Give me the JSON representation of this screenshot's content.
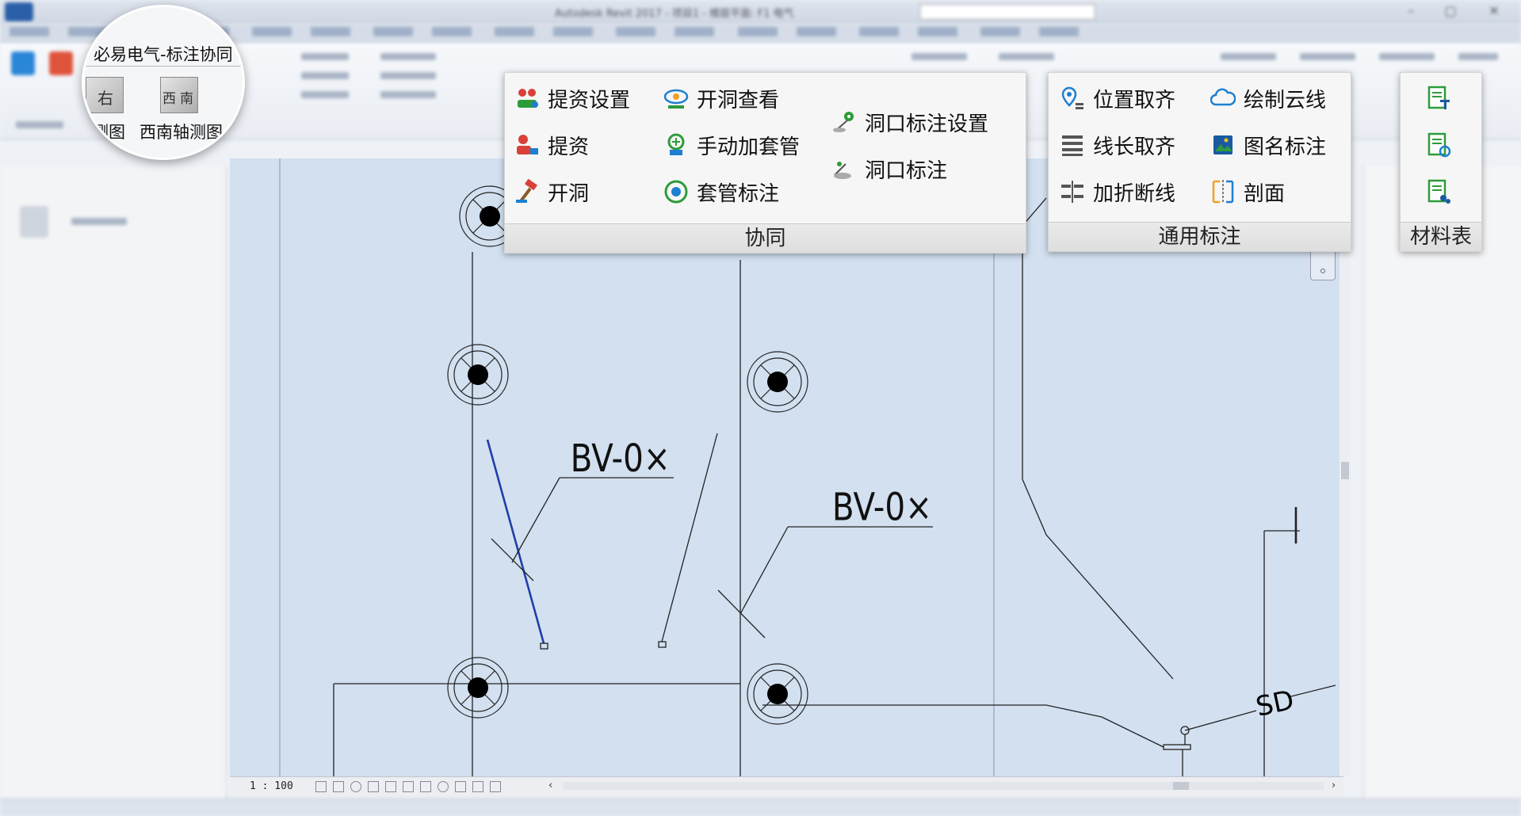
{
  "window": {
    "title": "Autodesk Revit 2017 -  项目1 - 楼层平面: F1 电气",
    "controls": [
      "minimize-icon",
      "restore-icon",
      "close-icon"
    ]
  },
  "view": {
    "scale": "1 : 100",
    "annotations": {
      "wire_label_1": "BV-0×",
      "wire_label_2": "BV-0×",
      "tag_sd": "SD"
    }
  },
  "magnifier": {
    "title": "必易电气-标注协同",
    "cube_left_face": "右",
    "cube_right_face_a": "西",
    "cube_right_face_b": "南",
    "left_label": "测图",
    "right_label": "西南轴测图"
  },
  "panels": {
    "collab": {
      "title": "协同",
      "tools": [
        {
          "label": "提资设置",
          "icon": "tiziyi-settings-icon"
        },
        {
          "label": "提资",
          "icon": "tizi-icon"
        },
        {
          "label": "开洞",
          "icon": "hammer-icon"
        },
        {
          "label": "开洞查看",
          "icon": "eye-view-icon"
        },
        {
          "label": "手动加套管",
          "icon": "sleeve-add-icon"
        },
        {
          "label": "套管标注",
          "icon": "sleeve-tag-icon"
        },
        {
          "label": "洞口标注设置",
          "icon": "opening-tag-settings-icon"
        },
        {
          "label": "洞口标注",
          "icon": "opening-tag-icon"
        }
      ]
    },
    "general": {
      "title": "通用标注",
      "tools": [
        {
          "label": "位置取齐",
          "icon": "location-align-icon"
        },
        {
          "label": "线长取齐",
          "icon": "line-length-align-icon"
        },
        {
          "label": "加折断线",
          "icon": "break-line-icon"
        },
        {
          "label": "绘制云线",
          "icon": "revision-cloud-icon"
        },
        {
          "label": "图名标注",
          "icon": "view-title-icon"
        },
        {
          "label": "剖面",
          "icon": "section-icon"
        }
      ]
    },
    "material": {
      "title": "材料表",
      "tools": [
        {
          "icon": "material-table-insert-icon"
        },
        {
          "icon": "material-table-settings-icon"
        },
        {
          "icon": "material-table-export-icon"
        }
      ]
    }
  },
  "colors": {
    "canvas_bg": "#d2e0f0",
    "selected_wire": "#1f3fa8",
    "icon_green": "#2e9b3a",
    "icon_blue": "#1d7fd1"
  }
}
